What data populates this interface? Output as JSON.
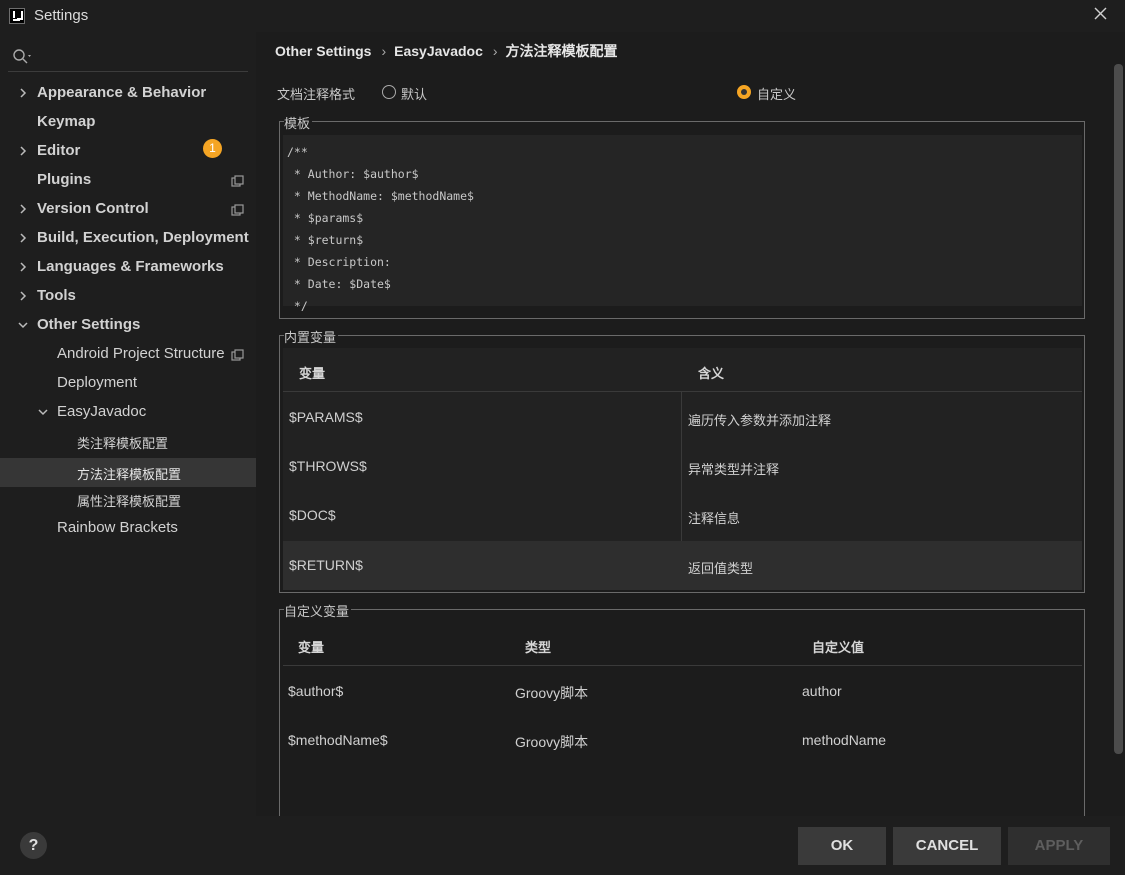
{
  "window": {
    "title": "Settings"
  },
  "search": {
    "placeholder": ""
  },
  "sidebar": {
    "items": [
      {
        "label": "Appearance & Behavior"
      },
      {
        "label": "Keymap"
      },
      {
        "label": "Editor"
      },
      {
        "label": "Plugins",
        "badge": "1"
      },
      {
        "label": "Version Control"
      },
      {
        "label": "Build, Execution, Deployment"
      },
      {
        "label": "Languages & Frameworks"
      },
      {
        "label": "Tools"
      },
      {
        "label": "Other Settings"
      },
      {
        "label": "Android Project Structure"
      },
      {
        "label": "Deployment"
      },
      {
        "label": "EasyJavadoc"
      },
      {
        "label": "类注释模板配置"
      },
      {
        "label": "方法注释模板配置"
      },
      {
        "label": "属性注释模板配置"
      },
      {
        "label": "Rainbow Brackets"
      }
    ]
  },
  "breadcrumb": [
    "Other Settings",
    "EasyJavadoc",
    "方法注释模板配置"
  ],
  "format": {
    "label": "文档注释格式",
    "options": [
      "默认",
      "自定义"
    ],
    "selected": "自定义"
  },
  "template": {
    "title": "模板",
    "lines": [
      "/**",
      " * Author: $author$",
      " * MethodName: $methodName$",
      " * $params$",
      " * $return$",
      " * Description:",
      " * Date: $Date$",
      " */"
    ]
  },
  "builtin_vars": {
    "title": "内置变量",
    "headers": [
      "变量",
      "含义"
    ],
    "rows": [
      [
        "$PARAMS$",
        "遍历传入参数并添加注释"
      ],
      [
        "$THROWS$",
        "异常类型并注释"
      ],
      [
        "$DOC$",
        "注释信息"
      ],
      [
        "$RETURN$",
        "返回值类型"
      ]
    ]
  },
  "custom_vars": {
    "title": "自定义变量",
    "headers": [
      "变量",
      "类型",
      "自定义值"
    ],
    "rows": [
      [
        "$author$",
        "Groovy脚本",
        "author"
      ],
      [
        "$methodName$",
        "Groovy脚本",
        "methodName"
      ]
    ]
  },
  "buttons": {
    "help": "?",
    "ok": "OK",
    "cancel": "CANCEL",
    "apply": "APPLY"
  },
  "colors": {
    "accent": "#f5a524",
    "background": "#1e1e1e",
    "selection": "#363636"
  }
}
